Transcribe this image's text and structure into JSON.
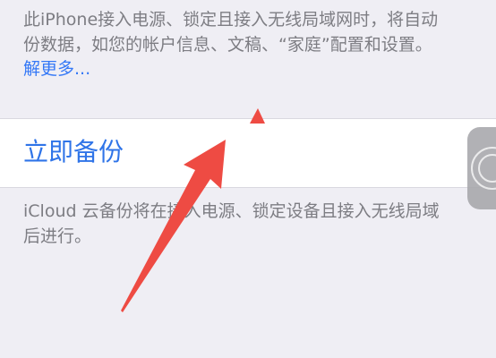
{
  "top_description": {
    "line1": "此iPhone接入电源、锁定且接入无线局域网时，将自动",
    "line2": "份数据，如您的帐户信息、文稿、“家庭”配置和设置。",
    "learn_more": "解更多..."
  },
  "backup": {
    "label": "立即备份"
  },
  "bottom_description": {
    "line1": "iCloud 云备份将在接入电源、锁定设备且接入无线局域",
    "line2": "后进行。"
  },
  "annotation": {
    "color": "#ee4b43",
    "icon": "red-arrow-pointer"
  }
}
